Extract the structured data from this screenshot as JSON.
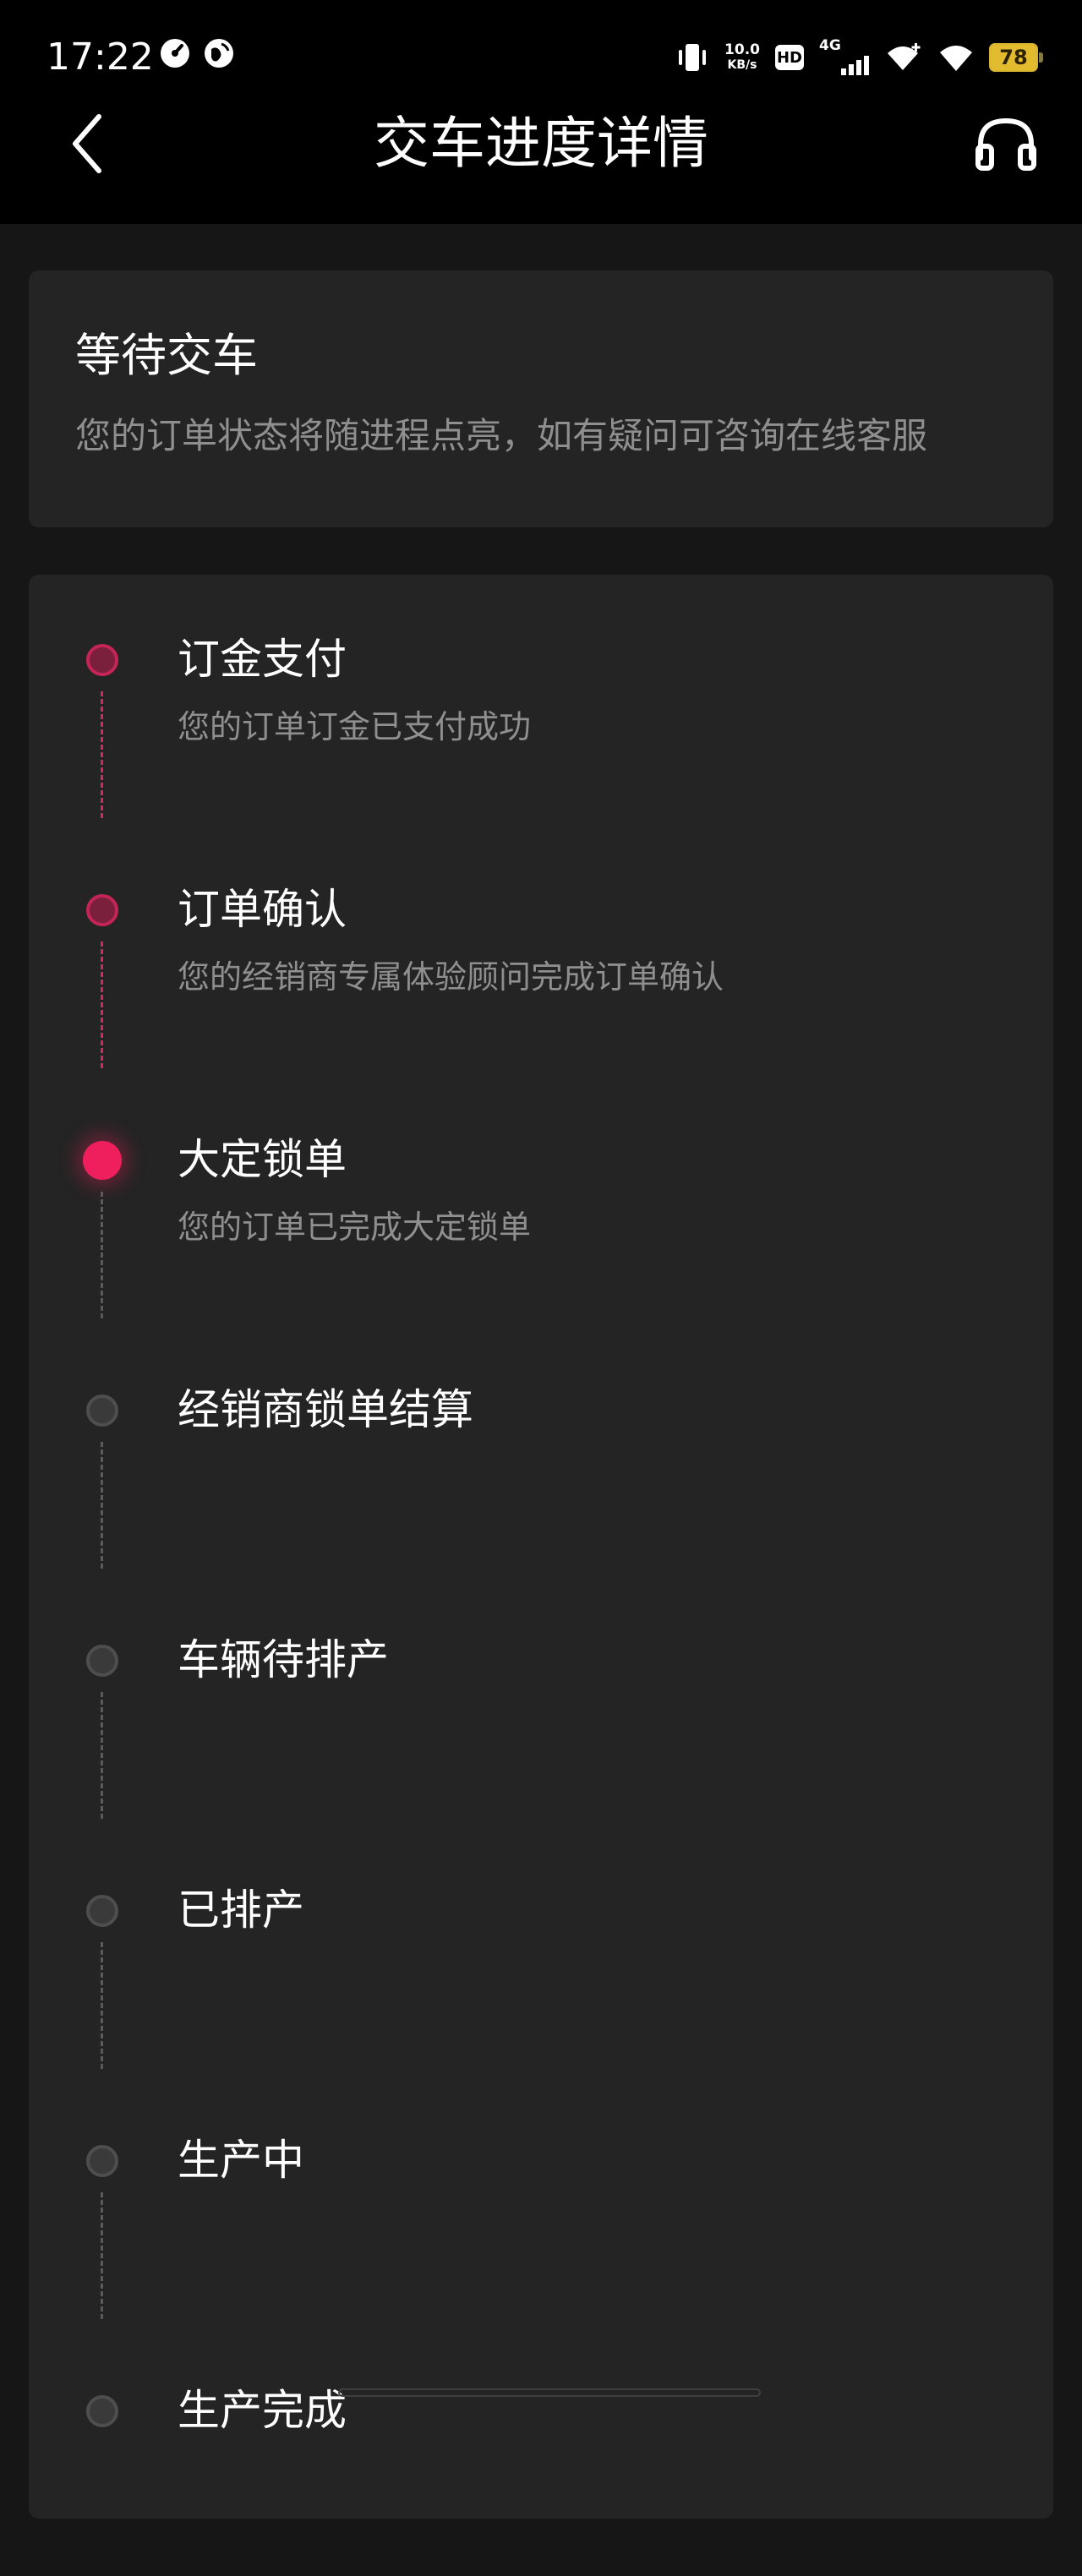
{
  "status_bar": {
    "time": "17:22",
    "speed_value": "10.0",
    "speed_unit": "KB/s",
    "hd_label": "HD",
    "network_label": "4G",
    "battery": "78"
  },
  "header": {
    "title": "交车进度详情"
  },
  "status_card": {
    "title": "等待交车",
    "description": "您的订单状态将随进程点亮，如有疑问可咨询在线客服"
  },
  "timeline": {
    "steps": [
      {
        "title": "订金支付",
        "description": "您的订单订金已支付成功",
        "state": "done"
      },
      {
        "title": "订单确认",
        "description": "您的经销商专属体验顾问完成订单确认",
        "state": "done"
      },
      {
        "title": "大定锁单",
        "description": "您的订单已完成大定锁单",
        "state": "current"
      },
      {
        "title": "经销商锁单结算",
        "description": "",
        "state": "pending"
      },
      {
        "title": "车辆待排产",
        "description": "",
        "state": "pending"
      },
      {
        "title": "已排产",
        "description": "",
        "state": "pending"
      },
      {
        "title": "生产中",
        "description": "",
        "state": "pending"
      },
      {
        "title": "生产完成",
        "description": "",
        "state": "pending"
      }
    ]
  },
  "colors": {
    "accent": "#ee1f5c",
    "background": "#161616",
    "card": "#242424"
  }
}
